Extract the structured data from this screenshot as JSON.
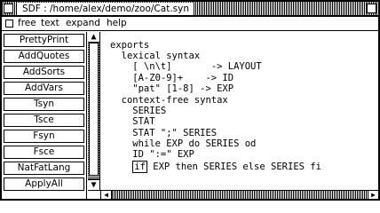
{
  "window": {
    "title": "SDF : /home/alex/demo/zoo/Cat.syn"
  },
  "menu": {
    "items": [
      "free",
      "text",
      "expand",
      "help"
    ]
  },
  "buttons": [
    "PrettyPrint",
    "AddQuotes",
    "AddSorts",
    "AddVars",
    "Tsyn",
    "Tsce",
    "Fsyn",
    "Fsce",
    "NatFatLang",
    "ApplyAll"
  ],
  "editor": {
    "lines": [
      "exports",
      "  lexical syntax",
      "    [ \\n\\t]       -> LAYOUT",
      "    [A-Z0-9]+    -> ID",
      "    \"pat\" [1-8] -> EXP",
      "  context-free syntax",
      "    SERIES",
      "    STAT",
      "    STAT \";\" SERIES",
      "    while EXP do SERIES od",
      "    ID \":=\" EXP"
    ],
    "cursor_token": "if",
    "cursor_line_rest": " EXP then SERIES else SERIES fi"
  },
  "icons": {
    "close": "close-box-icon",
    "resize": "zoom-box-icon",
    "scroll_up": "arrow-up-icon",
    "scroll_down": "arrow-down-icon",
    "scroll_left": "arrow-left-icon",
    "scroll_right": "arrow-right-icon"
  }
}
